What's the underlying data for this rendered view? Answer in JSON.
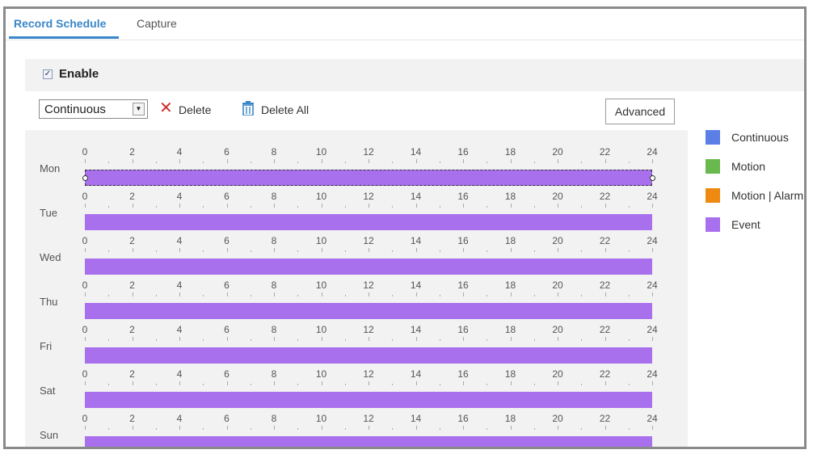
{
  "tabs": [
    {
      "label": "Record Schedule",
      "active": true
    },
    {
      "label": "Capture",
      "active": false
    }
  ],
  "enable": {
    "label": "Enable",
    "checked": true
  },
  "toolbar": {
    "mode_select": {
      "value": "Continuous"
    },
    "delete_label": "Delete",
    "delete_all_label": "Delete All",
    "advanced_label": "Advanced"
  },
  "schedule": {
    "hour_ticks": [
      "0",
      "2",
      "4",
      "6",
      "8",
      "10",
      "12",
      "14",
      "16",
      "18",
      "20",
      "22",
      "24"
    ],
    "days": [
      {
        "label": "Mon",
        "type": "Event",
        "start": 0,
        "end": 24,
        "selected": true
      },
      {
        "label": "Tue",
        "type": "Event",
        "start": 0,
        "end": 24,
        "selected": false
      },
      {
        "label": "Wed",
        "type": "Event",
        "start": 0,
        "end": 24,
        "selected": false
      },
      {
        "label": "Thu",
        "type": "Event",
        "start": 0,
        "end": 24,
        "selected": false
      },
      {
        "label": "Fri",
        "type": "Event",
        "start": 0,
        "end": 24,
        "selected": false
      },
      {
        "label": "Sat",
        "type": "Event",
        "start": 0,
        "end": 24,
        "selected": false
      },
      {
        "label": "Sun",
        "type": "Event",
        "start": 0,
        "end": 24,
        "selected": false
      }
    ]
  },
  "legend": [
    {
      "label": "Continuous",
      "color": "#5b7fe6"
    },
    {
      "label": "Motion",
      "color": "#6ab94f"
    },
    {
      "label": "Motion | Alarm",
      "color": "#ee8a12"
    },
    {
      "label": "Event",
      "color": "#a970ee"
    }
  ],
  "colors": {
    "accent": "#3a86c8",
    "event": "#a970ee",
    "delete": "#d02a2a",
    "trash": "#3a86c8"
  }
}
